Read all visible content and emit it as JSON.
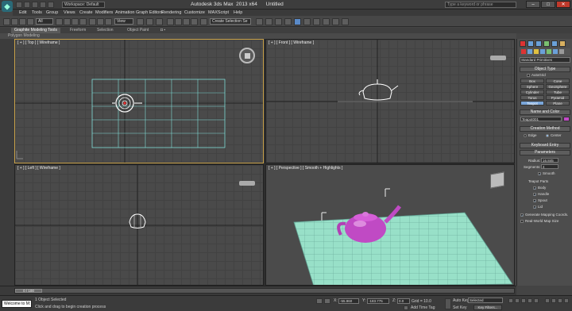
{
  "title_bar": {
    "workspace": "Workspace: Default",
    "title": "Autodesk 3ds Max  2013 x64      Untitled",
    "search_placeholder": "Type a keyword or phrase"
  },
  "menu": [
    "Edit",
    "Tools",
    "Group",
    "Views",
    "Create",
    "Modifiers",
    "Animation",
    "Graph Editors",
    "Rendering",
    "Customize",
    "MAXScript",
    "Help"
  ],
  "toolbar": {
    "selection_filter": "All",
    "reference_coord": "View",
    "named_selection": "Create Selection Se"
  },
  "ribbon": {
    "tabs": [
      "Graphite Modeling Tools",
      "Freeform",
      "Selection",
      "Object Paint"
    ],
    "sub_tab": "Polygon Modeling"
  },
  "viewports": {
    "top": "[ + ] [ Top ] [ Wireframe ]",
    "front": "[ + ] [ Front ] [ Wireframe ]",
    "left": "[ + ] [ Left ] [ Wireframe ]",
    "perspective": "[ + ] [ Perspective ] [ Smooth + Highlights ]"
  },
  "command_panel": {
    "category": "Standard Primitives",
    "object_type_header": "Object Type",
    "autogrid": "AutoGrid",
    "buttons": [
      "Box",
      "Cone",
      "Sphere",
      "GeoSphere",
      "Cylinder",
      "Tube",
      "Torus",
      "Pyramid",
      "Teapot",
      "Plane"
    ],
    "name_color_header": "Name and Color",
    "name_value": "Teapot001",
    "creation_method_header": "Creation Method",
    "creation_edge": "Edge",
    "creation_center": "Center",
    "keyboard_entry_header": "Keyboard Entry",
    "parameters_header": "Parameters",
    "radius_label": "Radius:",
    "radius_value": "16.845",
    "segments_label": "Segments:",
    "segments_value": "4",
    "smooth": "Smooth",
    "teapot_parts": "Teapot Parts",
    "parts": [
      "Body",
      "Handle",
      "Spout",
      "Lid"
    ],
    "gen_mapping": "Generate Mapping Coords.",
    "real_world": "Real-World Map Size"
  },
  "timeline": {
    "frame": "0 / 100"
  },
  "status": {
    "script_listener": "Welcome to M:",
    "selected": "1 Object Selected",
    "prompt": "Click and drag to begin creation process",
    "x_label": "X:",
    "x_value": "-55.960",
    "y_label": "Y:",
    "y_value": "-183.775",
    "z_label": "Z:",
    "z_value": "0.0",
    "grid": "Grid = 10.0",
    "add_time_tag": "Add Time Tag",
    "auto_key": "Auto Key",
    "selected_dropdown": "Selected",
    "set_key": "Set Key",
    "key_filters": "Key Filters..."
  }
}
